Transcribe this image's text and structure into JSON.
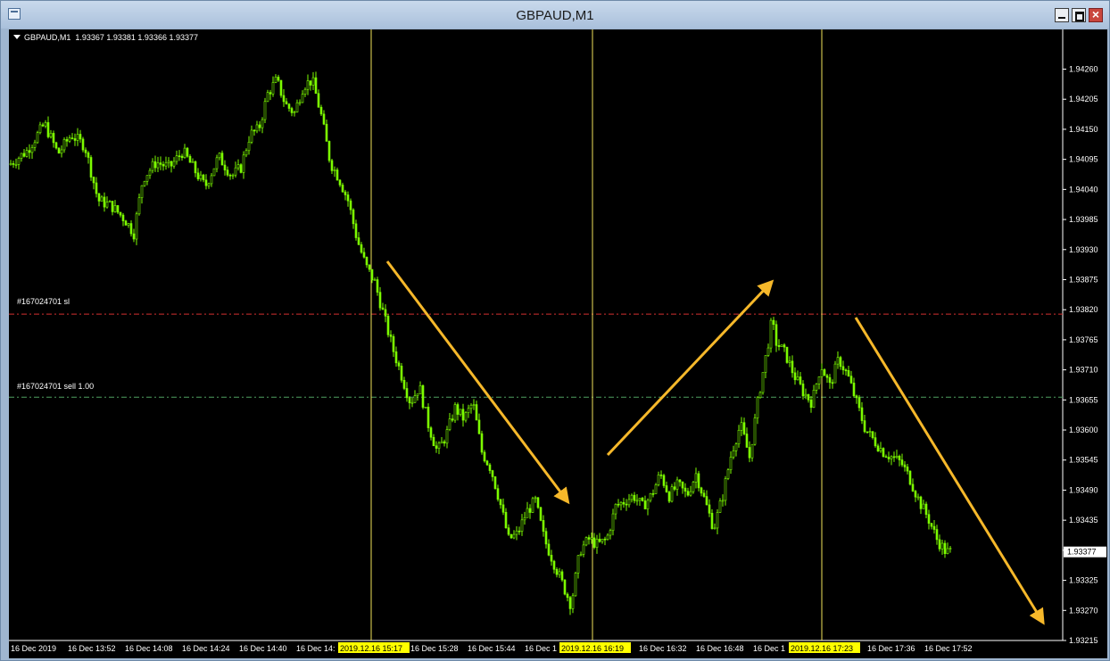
{
  "window": {
    "title": "GBPAUD,M1"
  },
  "header": {
    "symbol": "GBPAUD,M1",
    "ohlc": "1.93367 1.93381 1.93366 1.93377"
  },
  "colors": {
    "background": "#000000",
    "candle": "#7CFC00",
    "sl_line": "#d43030",
    "entry_line": "#4fa060",
    "vline": "#f1e25a",
    "arrow": "#f6b82a",
    "axis_text": "#ffffff",
    "highlight_label_bg": "#ffff00"
  },
  "chart_data": {
    "type": "candlestick",
    "symbol": "GBPAUD",
    "timeframe": "M1",
    "ylim": [
      1.93215,
      1.943
    ],
    "y_ticks": [
      "1.94260",
      "1.94205",
      "1.94150",
      "1.94095",
      "1.94040",
      "1.93985",
      "1.93930",
      "1.93875",
      "1.93820",
      "1.93765",
      "1.93710",
      "1.93655",
      "1.93600",
      "1.93545",
      "1.93490",
      "1.93435",
      "1.93380",
      "1.93325",
      "1.93270",
      "1.93215"
    ],
    "x_ticks": [
      "16 Dec 2019",
      "16 Dec 13:52",
      "16 Dec 14:08",
      "16 Dec 14:24",
      "16 Dec 14:40",
      "16 Dec 14:",
      "16 Dec 15:28",
      "16 Dec 15:44",
      "16 Dec 1",
      "16 Dec 16:32",
      "16 Dec 16:48",
      "16 Dec 1",
      "16 Dec 17:36",
      "16 Dec 17:52"
    ],
    "highlighted_times": [
      "2019.12.16 15:17",
      "2019.12.16 16:19",
      "2019.12.16 17:23"
    ],
    "current_price": "1.93377",
    "levels": [
      {
        "label": "#167024701 sl",
        "price": 1.93812
      },
      {
        "label": "#167024701 sell 1.00",
        "price": 1.9366
      }
    ],
    "close_path": [
      [
        0,
        1.94085
      ],
      [
        20,
        1.9411
      ],
      [
        40,
        1.9416
      ],
      [
        55,
        1.94105
      ],
      [
        70,
        1.9414
      ],
      [
        85,
        1.9412
      ],
      [
        100,
        1.9402
      ],
      [
        115,
        1.9401
      ],
      [
        130,
        1.93985
      ],
      [
        140,
        1.9396
      ],
      [
        150,
        1.9406
      ],
      [
        165,
        1.9409
      ],
      [
        180,
        1.9408
      ],
      [
        195,
        1.9411
      ],
      [
        210,
        1.9407
      ],
      [
        220,
        1.94045
      ],
      [
        235,
        1.941
      ],
      [
        250,
        1.94065
      ],
      [
        260,
        1.9408
      ],
      [
        270,
        1.9414
      ],
      [
        280,
        1.9415
      ],
      [
        290,
        1.94215
      ],
      [
        300,
        1.9424
      ],
      [
        310,
        1.94195
      ],
      [
        320,
        1.9418
      ],
      [
        330,
        1.9423
      ],
      [
        340,
        1.9424
      ],
      [
        350,
        1.94175
      ],
      [
        360,
        1.9409
      ],
      [
        370,
        1.9406
      ],
      [
        380,
        1.9402
      ],
      [
        390,
        1.9395
      ],
      [
        400,
        1.939
      ],
      [
        410,
        1.9387
      ],
      [
        420,
        1.9381
      ],
      [
        430,
        1.9375
      ],
      [
        440,
        1.937
      ],
      [
        450,
        1.9365
      ],
      [
        460,
        1.9368
      ],
      [
        470,
        1.9361
      ],
      [
        480,
        1.9356
      ],
      [
        490,
        1.9359
      ],
      [
        500,
        1.9364
      ],
      [
        510,
        1.9362
      ],
      [
        520,
        1.9365
      ],
      [
        530,
        1.9356
      ],
      [
        540,
        1.9353
      ],
      [
        550,
        1.9347
      ],
      [
        560,
        1.934
      ],
      [
        570,
        1.9341
      ],
      [
        580,
        1.9345
      ],
      [
        590,
        1.9347
      ],
      [
        600,
        1.934
      ],
      [
        610,
        1.9336
      ],
      [
        620,
        1.9332
      ],
      [
        630,
        1.9328
      ],
      [
        640,
        1.9338
      ],
      [
        650,
        1.934
      ],
      [
        660,
        1.9339
      ],
      [
        670,
        1.934
      ],
      [
        680,
        1.9346
      ],
      [
        690,
        1.9347
      ],
      [
        700,
        1.9348
      ],
      [
        710,
        1.9346
      ],
      [
        720,
        1.9348
      ],
      [
        730,
        1.9352
      ],
      [
        740,
        1.9348
      ],
      [
        750,
        1.935
      ],
      [
        760,
        1.9348
      ],
      [
        770,
        1.9352
      ],
      [
        780,
        1.9347
      ],
      [
        790,
        1.9342
      ],
      [
        800,
        1.9348
      ],
      [
        810,
        1.9356
      ],
      [
        820,
        1.9361
      ],
      [
        830,
        1.9355
      ],
      [
        840,
        1.9366
      ],
      [
        850,
        1.9375
      ],
      [
        855,
        1.938
      ],
      [
        860,
        1.9376
      ],
      [
        870,
        1.9374
      ],
      [
        880,
        1.937
      ],
      [
        890,
        1.9367
      ],
      [
        900,
        1.9365
      ],
      [
        910,
        1.9372
      ],
      [
        920,
        1.9368
      ],
      [
        930,
        1.9373
      ],
      [
        940,
        1.937
      ],
      [
        950,
        1.9365
      ],
      [
        960,
        1.936
      ],
      [
        970,
        1.9358
      ],
      [
        980,
        1.9356
      ],
      [
        990,
        1.9355
      ],
      [
        1000,
        1.9354
      ],
      [
        1010,
        1.9351
      ],
      [
        1020,
        1.9347
      ],
      [
        1030,
        1.9344
      ],
      [
        1040,
        1.934
      ],
      [
        1050,
        1.93377
      ]
    ]
  }
}
